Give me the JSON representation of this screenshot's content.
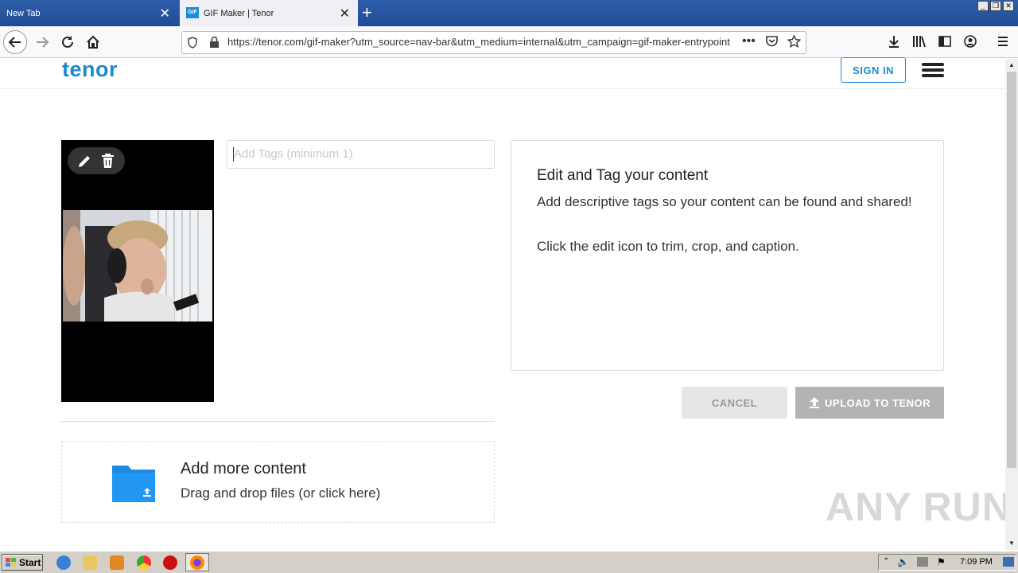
{
  "browser": {
    "tabs": [
      {
        "label": "New Tab"
      },
      {
        "label": "GIF Maker | Tenor",
        "favicon": "GIF"
      }
    ],
    "url": "https://tenor.com/gif-maker?utm_source=nav-bar&utm_medium=internal&utm_campaign=gif-maker-entrypoint"
  },
  "page": {
    "logo": "tenor",
    "sign_in": "SIGN IN",
    "tags_placeholder": "Add Tags (minimum 1)",
    "panel": {
      "title": "Edit and Tag your content",
      "line1": "Add descriptive tags so your content can be found and shared!",
      "line2": "Click the edit icon to trim, crop, and caption."
    },
    "cancel": "CANCEL",
    "upload": "UPLOAD TO TENOR",
    "add_more": {
      "title": "Add more content",
      "subtitle": "Drag and drop files (or click here)"
    }
  },
  "watermark": "ANY RUN",
  "taskbar": {
    "start": "Start",
    "clock": "7:09 PM"
  },
  "colors": {
    "brand": "#1b8bd0",
    "folder": "#2196f3"
  }
}
